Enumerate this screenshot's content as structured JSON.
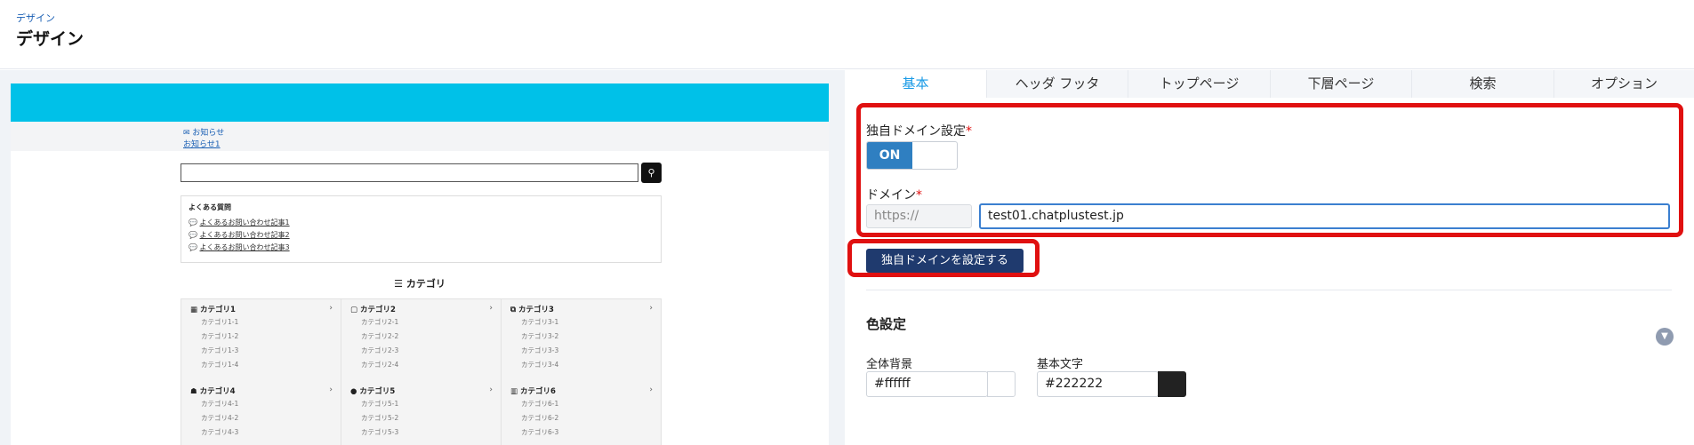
{
  "header": {
    "breadcrumb": "デザイン",
    "title": "デザイン"
  },
  "preview": {
    "notice_title": "お知らせ",
    "notice_link": "お知らせ1",
    "faq": {
      "title": "よくある質問",
      "items": [
        "よくあるお問い合わせ記事1",
        "よくあるお問い合わせ記事2",
        "よくあるお問い合わせ記事3"
      ]
    },
    "category_heading": "カテゴリ",
    "categories": [
      {
        "title": "カテゴリ1",
        "subs": [
          "カテゴリ1-1",
          "カテゴリ1-2",
          "カテゴリ1-3",
          "カテゴリ1-4"
        ]
      },
      {
        "title": "カテゴリ2",
        "subs": [
          "カテゴリ2-1",
          "カテゴリ2-2",
          "カテゴリ2-3",
          "カテゴリ2-4"
        ]
      },
      {
        "title": "カテゴリ3",
        "subs": [
          "カテゴリ3-1",
          "カテゴリ3-2",
          "カテゴリ3-3",
          "カテゴリ3-4"
        ]
      },
      {
        "title": "カテゴリ4",
        "subs": [
          "カテゴリ4-1",
          "カテゴリ4-2",
          "カテゴリ4-3"
        ]
      },
      {
        "title": "カテゴリ5",
        "subs": [
          "カテゴリ5-1",
          "カテゴリ5-2",
          "カテゴリ5-3"
        ]
      },
      {
        "title": "カテゴリ6",
        "subs": [
          "カテゴリ6-1",
          "カテゴリ6-2",
          "カテゴリ6-3"
        ]
      }
    ],
    "header_color": "#00c1e8"
  },
  "tabs": [
    "基本",
    "ヘッダ フッタ",
    "トップページ",
    "下層ページ",
    "検索",
    "オプション"
  ],
  "domain_settings": {
    "custom_domain_label": "独自ドメイン設定",
    "required_mark": "*",
    "toggle_on_label": "ON",
    "domain_label": "ドメイン",
    "protocol_prefix": "https://",
    "domain_value": "test01.chatplustest.jp",
    "set_button_label": "独自ドメインを設定する"
  },
  "color_settings": {
    "title": "色設定",
    "background_label": "全体背景",
    "background_value": "#ffffff",
    "text_label": "基本文字",
    "text_value": "#222222"
  },
  "colors": {
    "accent": "#1a9be6",
    "highlight_box": "#e01010",
    "primary_button": "#1f3a6e",
    "toggle_on": "#2f7fc1"
  }
}
